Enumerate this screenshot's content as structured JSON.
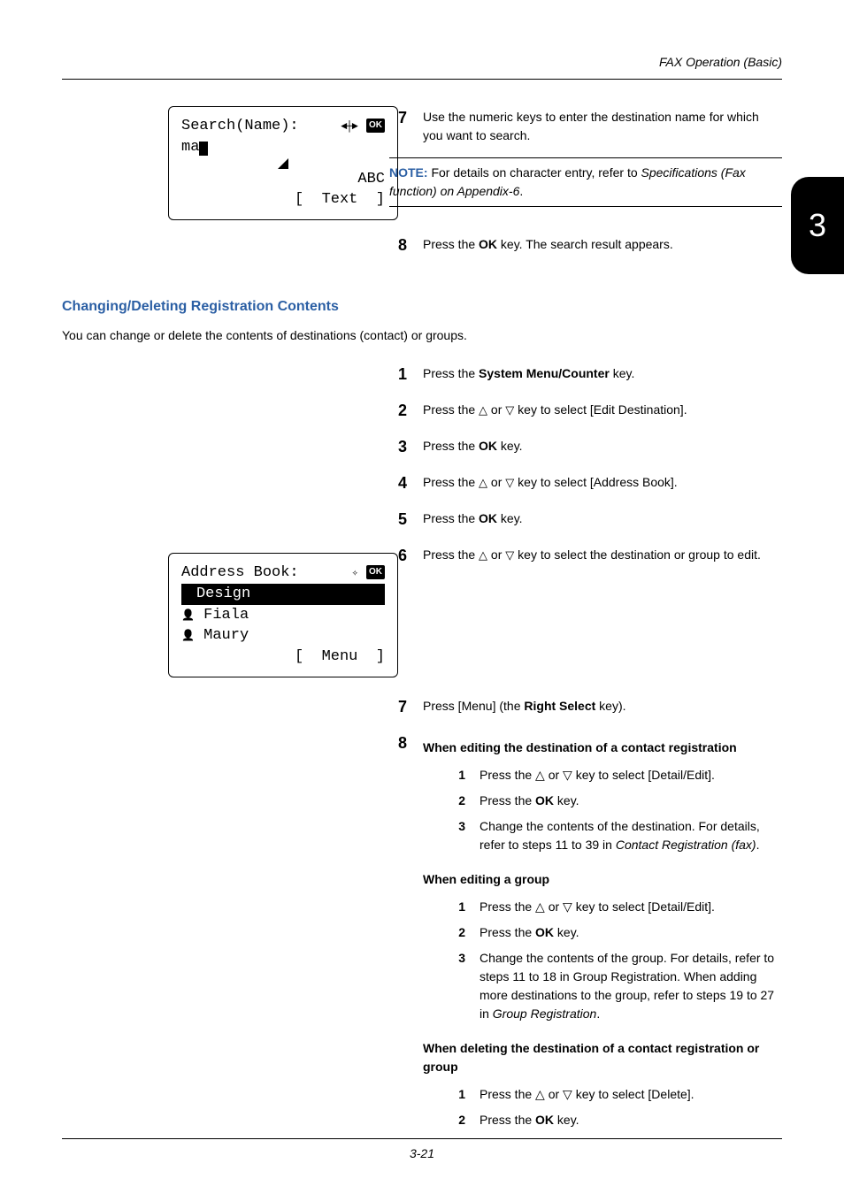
{
  "header": "FAX Operation (Basic)",
  "chapter_tab": "3",
  "footer": "3-21",
  "lcd1": {
    "title": "Search(Name):",
    "input_prefix": "ma",
    "right_text1": "ABC",
    "right_text2": "[  Text  ]",
    "ok": "OK"
  },
  "step7_top": {
    "num": "7",
    "text": "Use the numeric keys to enter the destination name for which you want to search."
  },
  "note": {
    "label": "NOTE:",
    "text_pre": " For details on character entry, refer to ",
    "italic1": "Specifications (Fax function) on Appendix-6",
    "text_post": "."
  },
  "step8_top": {
    "num": "8",
    "pre": "Press the ",
    "bold": "OK",
    "post": " key. The search result appears."
  },
  "section_heading": "Changing/Deleting Registration Contents",
  "section_intro": "You can change or delete the contents of destinations (contact) or groups.",
  "steps_main": [
    {
      "num": "1",
      "parts": [
        "Press the ",
        "System Menu/Counter",
        " key."
      ]
    },
    {
      "num": "2",
      "parts": [
        "Press the ",
        "△",
        " or ",
        "▽",
        " key to select [Edit Destination]."
      ]
    },
    {
      "num": "3",
      "parts": [
        "Press the ",
        "OK",
        " key."
      ]
    },
    {
      "num": "4",
      "parts": [
        "Press the ",
        "△",
        " or ",
        "▽",
        " key to select [Address Book]."
      ]
    },
    {
      "num": "5",
      "parts": [
        "Press the ",
        "OK",
        " key."
      ]
    },
    {
      "num": "6",
      "parts": [
        "Press the ",
        "△",
        " or ",
        "▽",
        " key to select the destination or group to edit."
      ]
    }
  ],
  "lcd2": {
    "title": "Address Book:",
    "ok": "OK",
    "row1": "Design",
    "row2": "Fiala",
    "row3": "Maury",
    "menu": "[  Menu  ]"
  },
  "step7_b": {
    "num": "7",
    "pre": "Press [Menu] (the ",
    "bold": "Right Select",
    "post": " key)."
  },
  "step8_b": {
    "num": "8",
    "head": "When editing the destination of a contact registration",
    "sub": [
      {
        "n": "1",
        "t_pre": "Press the ",
        "t_mid1": "△",
        "t_mid2": " or ",
        "t_mid3": "▽",
        "t_post": " key to select [Detail/Edit]."
      },
      {
        "n": "2",
        "t_pre": "Press the ",
        "t_bold": "OK",
        "t_post": " key."
      },
      {
        "n": "3",
        "t_pre": "Change the contents of the destination. For details, refer to steps 11 to 39 in ",
        "t_italic": "Contact Registration (fax)",
        "t_post": "."
      }
    ],
    "head2": "When editing a group",
    "sub2": [
      {
        "n": "1",
        "t_pre": "Press the ",
        "t_mid1": "△",
        "t_mid2": " or ",
        "t_mid3": "▽",
        "t_post": " key to select [Detail/Edit]."
      },
      {
        "n": "2",
        "t_pre": "Press the ",
        "t_bold": "OK",
        "t_post": " key."
      },
      {
        "n": "3",
        "t_pre": "Change the contents of the group. For details, refer to steps 11 to 18 in Group Registration. When adding more destinations to the group, refer to steps 19 to 27 in ",
        "t_italic": "Group Registration",
        "t_post": "."
      }
    ],
    "head3": "When deleting the destination of a contact registration or group",
    "sub3": [
      {
        "n": "1",
        "t_pre": "Press the ",
        "t_mid1": "△",
        "t_mid2": " or ",
        "t_mid3": "▽",
        "t_post": " key to select [Delete]."
      },
      {
        "n": "2",
        "t_pre": "Press the ",
        "t_bold": "OK",
        "t_post": " key."
      }
    ]
  }
}
